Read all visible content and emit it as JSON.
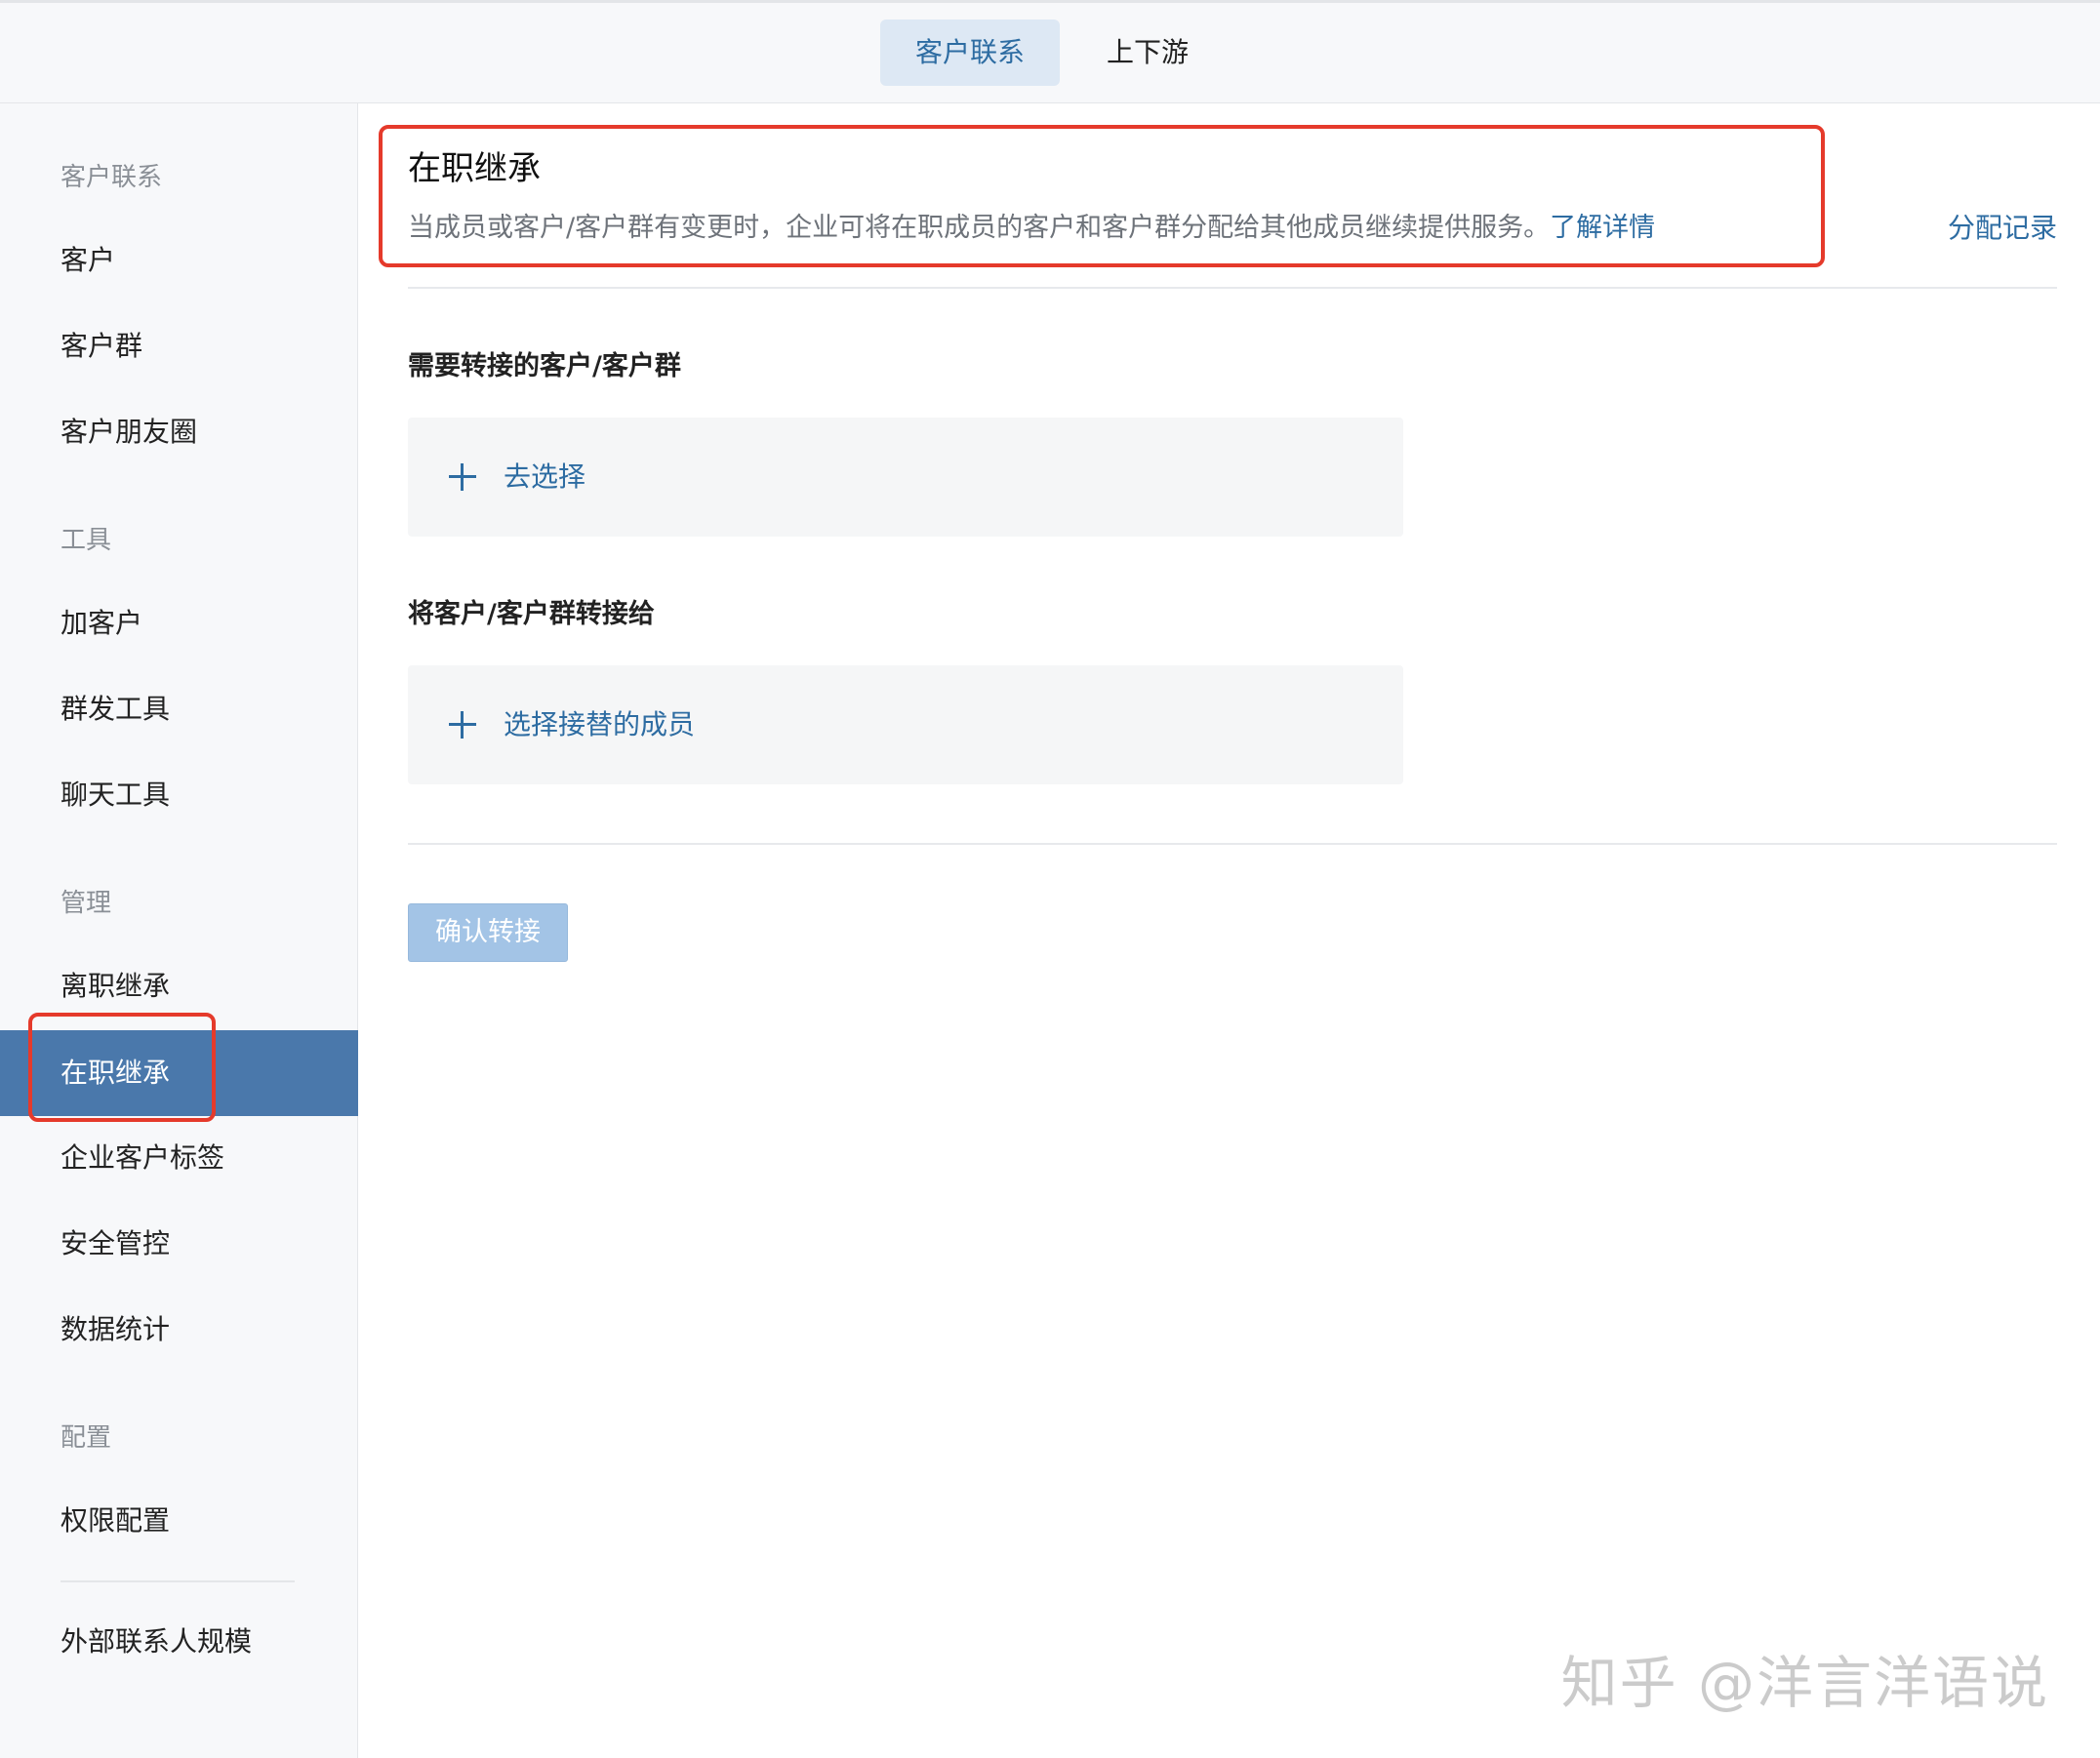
{
  "top_tabs": [
    {
      "label": "客户联系",
      "active": true
    },
    {
      "label": "上下游",
      "active": false
    }
  ],
  "sidebar": {
    "groups": [
      {
        "title": "客户联系",
        "items": [
          "客户",
          "客户群",
          "客户朋友圈"
        ]
      },
      {
        "title": "工具",
        "items": [
          "加客户",
          "群发工具",
          "聊天工具"
        ]
      },
      {
        "title": "管理",
        "items": [
          "离职继承",
          "在职继承",
          "企业客户标签",
          "安全管控",
          "数据统计"
        ]
      },
      {
        "title": "配置",
        "items": [
          "权限配置"
        ]
      }
    ],
    "extra_item": "外部联系人规模",
    "selected": "在职继承"
  },
  "main": {
    "title": "在职继承",
    "description": "当成员或客户/客户群有变更时，企业可将在职成员的客户和客户群分配给其他成员继续提供服务。",
    "learn_more": "了解详情",
    "record_link": "分配记录",
    "section1_label": "需要转接的客户/客户群",
    "section1_action": "去选择",
    "section2_label": "将客户/客户群转接给",
    "section2_action": "选择接替的成员",
    "confirm_button": "确认转接"
  },
  "colors": {
    "accent": "#2d6ca2",
    "selected_bg": "#4a78ab",
    "highlight": "#e53a2b",
    "disabled_button": "#a3c4e6"
  },
  "watermark": "知乎 @洋言洋语说"
}
